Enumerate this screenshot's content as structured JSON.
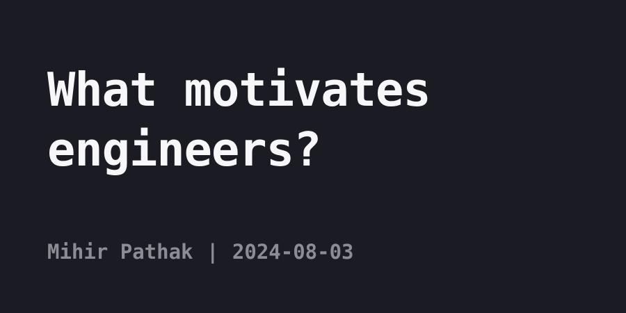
{
  "post": {
    "title": "What motivates engineers?",
    "author": "Mihir Pathak",
    "separator": "|",
    "date": "2024-08-03"
  },
  "colors": {
    "background": "#1b1c23",
    "title": "#f7f7f9",
    "meta": "#8c8d94"
  }
}
